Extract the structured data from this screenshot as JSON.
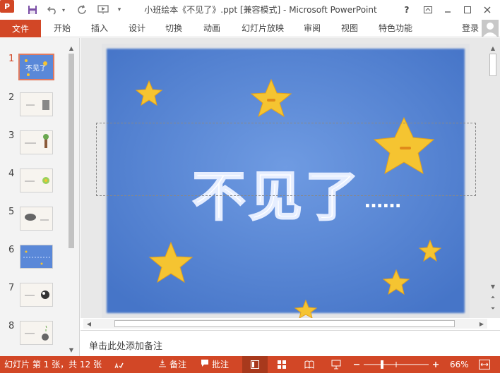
{
  "titlebar": {
    "title": "小班绘本《不见了》.ppt [兼容模式] - Microsoft PowerPoint",
    "help": "?",
    "logo_letter": "P"
  },
  "ribbon": {
    "file": "文件",
    "tabs": [
      "开始",
      "插入",
      "设计",
      "切换",
      "动画",
      "幻灯片放映",
      "审阅",
      "视图",
      "特色功能"
    ],
    "login": "登录"
  },
  "thumbnails": [
    {
      "num": "1",
      "active": true
    },
    {
      "num": "2",
      "active": false
    },
    {
      "num": "3",
      "active": false
    },
    {
      "num": "4",
      "active": false
    },
    {
      "num": "5",
      "active": false
    },
    {
      "num": "6",
      "active": false
    },
    {
      "num": "7",
      "active": false
    },
    {
      "num": "8",
      "active": false
    }
  ],
  "slide": {
    "title_text": "不见了",
    "dots": "……"
  },
  "notes": {
    "placeholder": "单击此处添加备注"
  },
  "statusbar": {
    "slide_info": "幻灯片 第 1 张，共 12 张",
    "notes_label": "备注",
    "comments_label": "批注",
    "zoom": "66%"
  },
  "colors": {
    "accent": "#d24726",
    "slide_bg": "#4d7fd1",
    "star": "#f5c431"
  },
  "icons": [
    "powerpoint-logo-icon",
    "save-icon",
    "undo-icon",
    "redo-icon",
    "present-from-start-icon",
    "customize-qat-icon",
    "help-icon",
    "ribbon-display-icon",
    "minimize-icon",
    "maximize-icon",
    "close-icon",
    "notes-icon",
    "comments-icon",
    "normal-view-icon",
    "slide-sorter-icon",
    "reading-view-icon",
    "slideshow-icon",
    "fit-slide-icon"
  ]
}
